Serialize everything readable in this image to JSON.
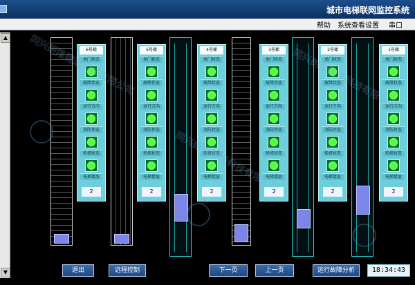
{
  "window": {
    "title": "城市电梯联网监控系统"
  },
  "menu": {
    "help": "帮助",
    "view": "系统查看",
    "settings": "设置",
    "port": "串口"
  },
  "panels": [
    {
      "name": "1号梯",
      "rows": [
        "关门状态",
        "故障状态",
        "运行方向",
        "消防状态",
        "检修状态",
        "电梯楼层"
      ],
      "floor": "2"
    },
    {
      "name": "2号梯",
      "rows": [
        "关门状态",
        "故障状态",
        "运行方向",
        "消防状态",
        "检修状态",
        "电梯楼层"
      ],
      "floor": "2"
    },
    {
      "name": "3号梯",
      "rows": [
        "关门状态",
        "故障状态",
        "运行方向",
        "消防状态",
        "检修状态",
        "电梯楼层"
      ],
      "floor": "2"
    },
    {
      "name": "4号梯",
      "rows": [
        "关门状态",
        "故障状态",
        "运行方向",
        "消防状态",
        "检修状态",
        "电梯楼层"
      ],
      "floor": "2"
    },
    {
      "name": "5号梯",
      "rows": [
        "关门状态",
        "故障状态",
        "运行方向",
        "消防状态",
        "检修状态",
        "电梯楼层"
      ],
      "floor": "2"
    },
    {
      "name": "6号梯",
      "rows": [
        "关门状态",
        "故障状态",
        "运行方向",
        "消防状态",
        "检修状态",
        "电梯楼层"
      ],
      "floor": "2"
    }
  ],
  "buttons": {
    "exit": "退出",
    "remote": "远程控制",
    "prev": "上一页",
    "next": "下一页",
    "status": "运行故障分析"
  },
  "clock": "18:34:43",
  "watermark": "同兴朗隆建通科技有限公司",
  "colors": {
    "panel": "#6ecfdc",
    "shaft": "#2ad2c8",
    "cab": "#7b86e8",
    "ok": "#4dff3d"
  }
}
